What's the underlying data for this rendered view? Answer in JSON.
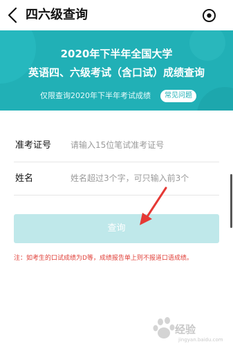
{
  "header": {
    "title": "四六级查询",
    "back_icon": "chevron-left-icon",
    "menu_icon": "record-target-icon"
  },
  "banner": {
    "line1": "2020年下半年全国大学",
    "line2": "英语四、六级考试（含口试）成绩查询",
    "subtitle": "仅限查询2020年下半年考试成绩",
    "faq_label": "常见问题",
    "background_color": "#21b0b6"
  },
  "form": {
    "exam_id": {
      "label": "准考证号",
      "value": "",
      "placeholder": "请输入15位笔试准考证号"
    },
    "name": {
      "label": "姓名",
      "value": "",
      "placeholder": "姓名超过3个字，可只输入前3个"
    },
    "submit_label": "查询",
    "submit_color": "#bfe8ea"
  },
  "note": "注：如考生的口试成绩为D等，成绩报告单上则不报道口语成绩。",
  "watermark": {
    "text": "经验",
    "subtext": "jingyan.baidu.com"
  },
  "colors": {
    "accent": "#21b0b6",
    "warning": "#e0413a",
    "annotation_arrow": "#e53935"
  }
}
